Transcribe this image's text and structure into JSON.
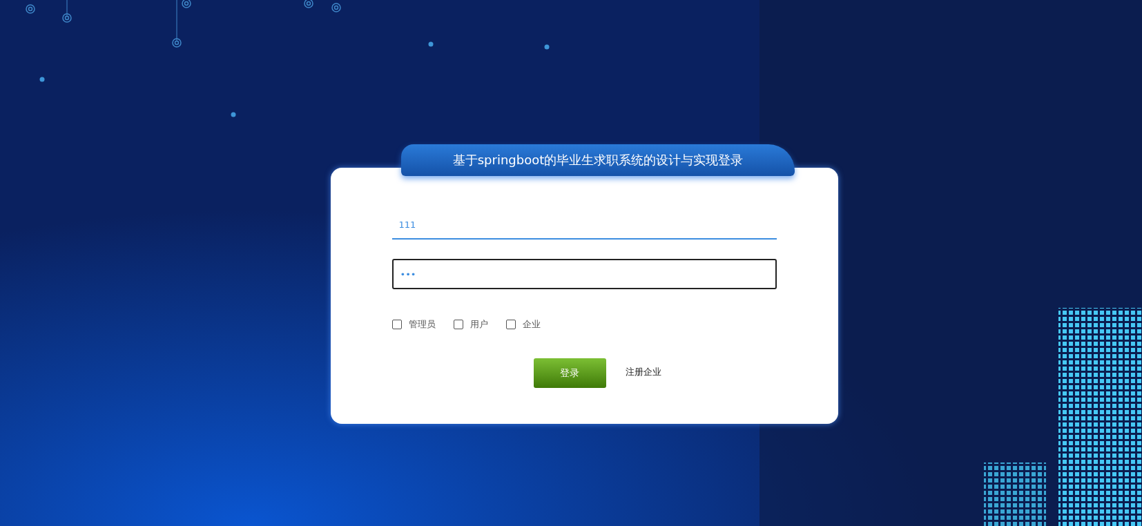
{
  "login": {
    "title": "基于springboot的毕业生求职系统的设计与实现登录",
    "username": {
      "value": "111"
    },
    "password": {
      "value": "•••"
    },
    "roles": [
      {
        "label": "管理员",
        "checked": false
      },
      {
        "label": "用户",
        "checked": false
      },
      {
        "label": "企业",
        "checked": false
      }
    ],
    "submit": "登录",
    "register_link": "注册企业"
  }
}
